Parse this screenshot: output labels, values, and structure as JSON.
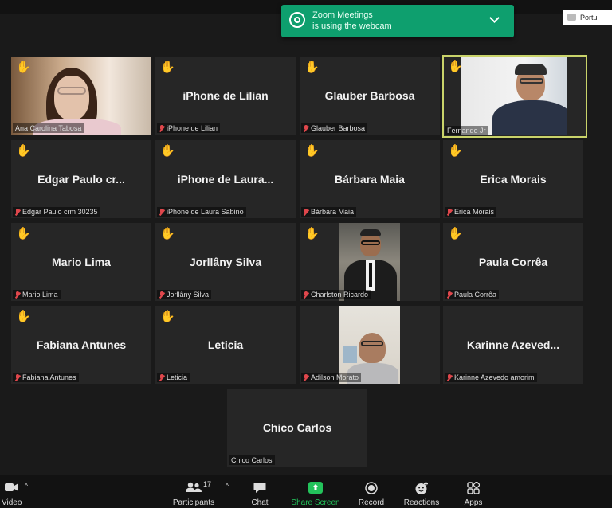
{
  "notification": {
    "line1": "Zoom Meetings",
    "line2": "is using the webcam"
  },
  "language_button": {
    "label": "Portu"
  },
  "participants_tiles": [
    {
      "name": "Ana Carolina Tabosa",
      "display": "",
      "hand": true,
      "video": true,
      "muted": false
    },
    {
      "name": "iPhone de Lilian",
      "display": "iPhone de Lilian",
      "hand": true,
      "video": false,
      "muted": true
    },
    {
      "name": "Glauber Barbosa",
      "display": "Glauber Barbosa",
      "hand": true,
      "video": false,
      "muted": true
    },
    {
      "name": "Fernando Jr",
      "display": "",
      "hand": true,
      "video": true,
      "muted": false,
      "active_speaker": true
    },
    {
      "name": "Edgar Paulo crm 30235",
      "display": "Edgar Paulo cr...",
      "hand": true,
      "video": false,
      "muted": true
    },
    {
      "name": "iPhone de Laura Sabino",
      "display": "iPhone de Laura...",
      "hand": true,
      "video": false,
      "muted": true
    },
    {
      "name": "Bárbara Maia",
      "display": "Bárbara Maia",
      "hand": true,
      "video": false,
      "muted": true
    },
    {
      "name": "Erica Morais",
      "display": "Erica Morais",
      "hand": true,
      "video": false,
      "muted": true
    },
    {
      "name": "Mario Lima",
      "display": "Mario Lima",
      "hand": true,
      "video": false,
      "muted": true
    },
    {
      "name": "Jorllâny Silva",
      "display": "Jorllâny Silva",
      "hand": true,
      "video": false,
      "muted": true
    },
    {
      "name": "Charlston Ricardo",
      "display": "",
      "hand": true,
      "video": true,
      "muted": true
    },
    {
      "name": "Paula Corrêa",
      "display": "Paula Corrêa",
      "hand": true,
      "video": false,
      "muted": true
    },
    {
      "name": "Fabiana Antunes",
      "display": "Fabiana Antunes",
      "hand": true,
      "video": false,
      "muted": true
    },
    {
      "name": "Leticia",
      "display": "Leticia",
      "hand": true,
      "video": false,
      "muted": true
    },
    {
      "name": "Adilson Morato",
      "display": "",
      "hand": false,
      "video": true,
      "muted": true
    },
    {
      "name": "Karinne Azevedo amorim",
      "display": "Karinne  Azeved...",
      "hand": false,
      "video": false,
      "muted": true
    },
    {
      "name": "Chico Carlos",
      "display": "Chico Carlos",
      "hand": false,
      "video": false,
      "muted": false
    }
  ],
  "toolbar": {
    "video": "Video",
    "participants": "Participants",
    "participants_count": "17",
    "chat": "Chat",
    "share_screen": "Share Screen",
    "record": "Record",
    "reactions": "Reactions",
    "apps": "Apps"
  },
  "colors": {
    "accent_green": "#0e9f6e",
    "hand": "#f2b31b",
    "muted": "#e0474c",
    "share": "#23c35b"
  }
}
